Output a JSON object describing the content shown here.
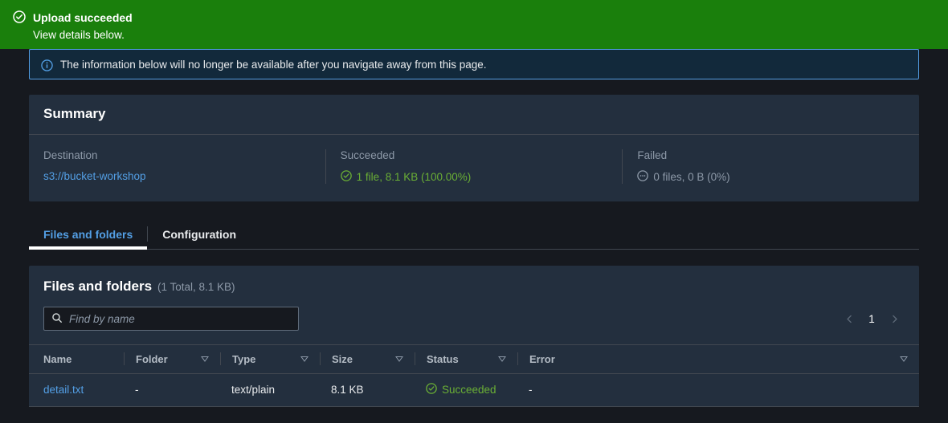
{
  "flash": {
    "icon": "status-positive-icon",
    "title": "Upload succeeded",
    "subtitle": "View details below."
  },
  "alert": {
    "icon": "info-icon",
    "text": "The information below will no longer be available after you navigate away from this page."
  },
  "summary": {
    "title": "Summary",
    "columns": [
      {
        "label": "Destination",
        "value": "s3://bucket-workshop",
        "type": "link"
      },
      {
        "label": "Succeeded",
        "value": "1 file, 8.1 KB (100.00%)",
        "type": "ok",
        "icon": "check-circle-icon"
      },
      {
        "label": "Failed",
        "value": "0 files, 0 B (0%)",
        "type": "none",
        "icon": "ellipsis-circle-icon"
      }
    ]
  },
  "tabs": [
    {
      "label": "Files and folders",
      "active": true
    },
    {
      "label": "Configuration",
      "active": false
    }
  ],
  "table_card": {
    "title": "Files and folders",
    "title_sub": "(1 Total, 8.1 KB)",
    "search": {
      "icon": "search-icon",
      "placeholder": "Find by name",
      "value": ""
    },
    "pagination": {
      "prev_icon": "chevron-left-icon",
      "next_icon": "chevron-right-icon",
      "current_page": "1"
    },
    "columns": [
      {
        "label": "Name",
        "filter": false
      },
      {
        "label": "Folder",
        "filter": true
      },
      {
        "label": "Type",
        "filter": true
      },
      {
        "label": "Size",
        "filter": true
      },
      {
        "label": "Status",
        "filter": true
      },
      {
        "label": "Error",
        "filter": true
      }
    ],
    "rows": [
      {
        "name": "detail.txt",
        "folder": "-",
        "type": "text/plain",
        "size": "8.1 KB",
        "status": "Succeeded",
        "status_icon": "check-circle-icon",
        "error": "-"
      }
    ]
  },
  "colors": {
    "flash_green": "#1a7f0c",
    "link_blue": "#539fe5",
    "success_green": "#6aaf35",
    "card_bg": "#232f3e",
    "page_bg": "#16191f",
    "muted": "#8d99a8"
  }
}
